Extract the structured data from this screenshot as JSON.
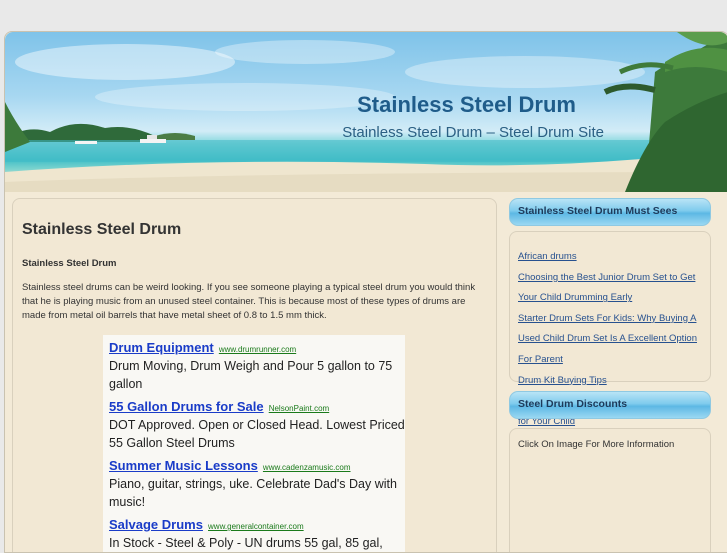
{
  "header": {
    "site_title": "Stainless Steel Drum",
    "site_description": "Stainless Steel Drum – Steel Drum Site"
  },
  "post": {
    "title": "Stainless Steel Drum",
    "subheading": "Stainless Steel Drum",
    "body": "Stainless steel drums can be weird looking. If you see someone playing a typical steel drum you would think that he is playing music from an unused steel container. This is because most of these types of drums are made from metal oil barrels that have metal sheet of 0.8 to 1.5 mm thick."
  },
  "ads": [
    {
      "title": "Drum Equipment",
      "url": "www.drumrunner.com",
      "text": "Drum Moving, Drum Weigh and Pour 5 gallon to 75 gallon"
    },
    {
      "title": "55 Gallon Drums for Sale",
      "url": "NelsonPaint.com",
      "text": "DOT Approved. Open or Closed Head. Lowest Priced 55 Gallon Steel Drums"
    },
    {
      "title": "Summer Music Lessons",
      "url": "www.cadenzamusic.com",
      "text": "Piano, guitar, strings, uke. Celebrate Dad's Day with music!"
    },
    {
      "title": "Salvage Drums",
      "url": "www.generalcontainer.com",
      "text": "In Stock - Steel & Poly - UN drums 55 gal, 85 gal,"
    }
  ],
  "sidebar": {
    "must_sees": {
      "heading": "Stainless Steel Drum Must Sees",
      "links": [
        "African drums",
        "Choosing the Best Junior Drum Set to Get Your Child Drumming Early",
        "Starter Drum Sets For Kids: Why Buying A Used Child Drum Set Is A Excellent Option For Parent",
        "Drum Kit Buying Tips",
        "Selecting The Right Size Junior Drum Set for Your Child"
      ]
    },
    "discounts": {
      "heading": "Steel Drum Discounts",
      "note": "Click On Image For More Information"
    }
  }
}
